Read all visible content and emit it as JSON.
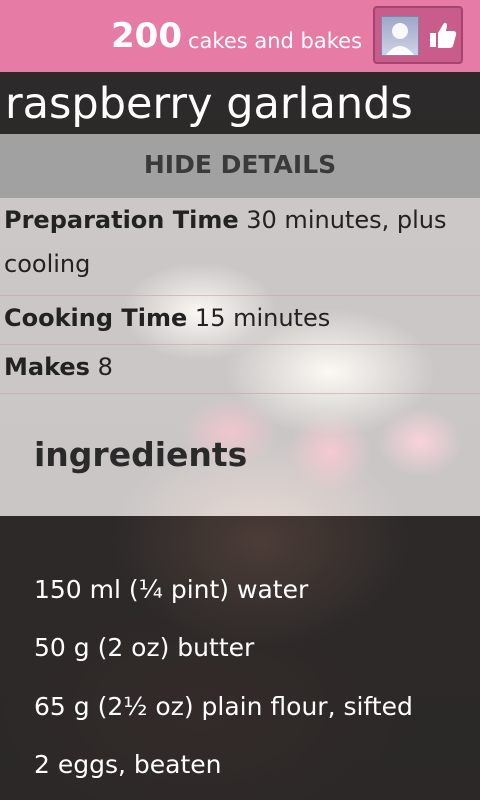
{
  "header": {
    "count": "200",
    "brand_text": "cakes and bakes",
    "avatar_icon": "user-avatar-icon",
    "like_icon": "thumbs-up-icon",
    "background_color": "#e67ba6"
  },
  "recipe": {
    "title": "raspberry garlands",
    "hide_details_label": "HIDE DETAILS",
    "details": {
      "prep_label": "Preparation Time",
      "prep_value": "30 minutes, plus cooling",
      "cook_label": "Cooking Time",
      "cook_value": "15 minutes",
      "makes_label": "Makes",
      "makes_value": "8"
    },
    "ingredients_heading": "ingredients",
    "ingredients": [
      "150 ml (¼ pint) water",
      "50 g (2 oz) butter",
      "65 g (2½ oz) plain flour, sifted",
      "2 eggs, beaten"
    ]
  }
}
